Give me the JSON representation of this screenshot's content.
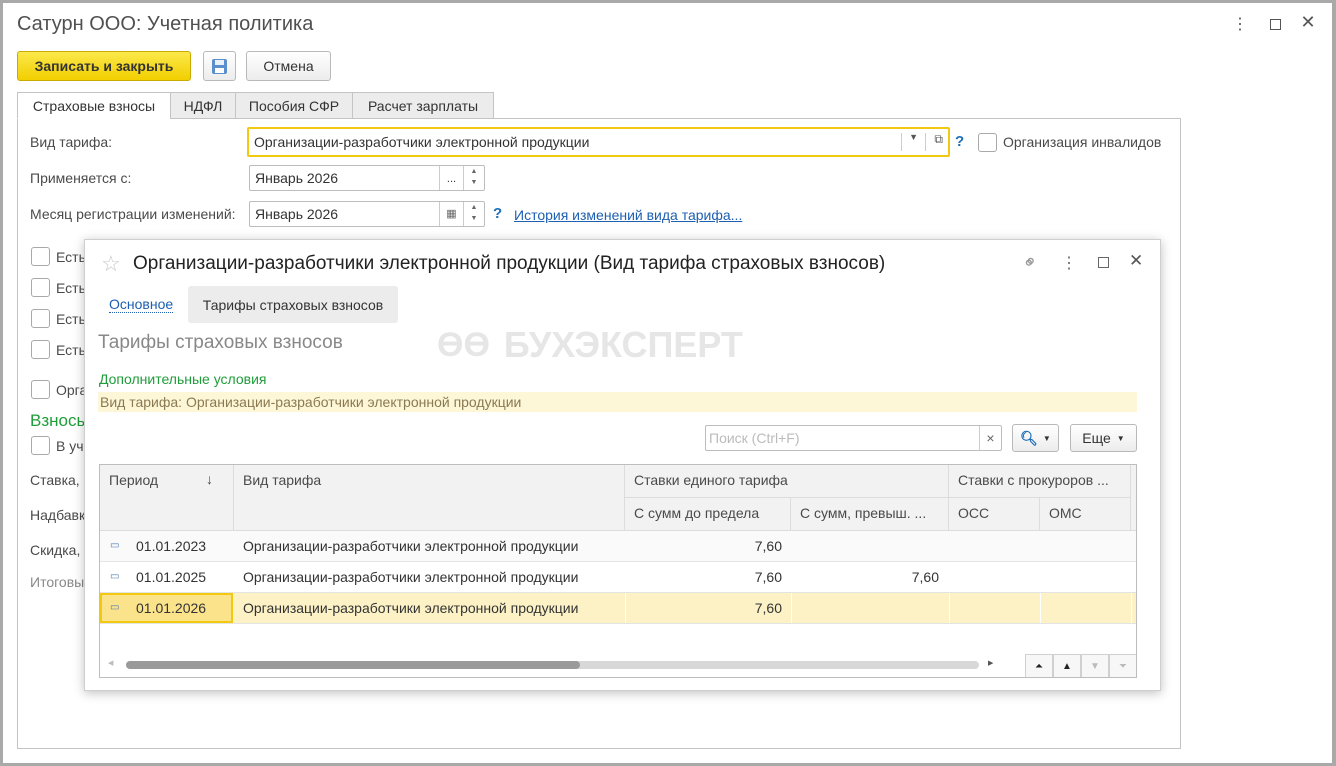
{
  "window": {
    "title": "Сатурн ООО: Учетная политика"
  },
  "toolbar": {
    "save_close": "Записать и закрыть",
    "cancel": "Отмена"
  },
  "tabs": [
    {
      "label": "Страховые взносы"
    },
    {
      "label": "НДФЛ"
    },
    {
      "label": "Пособия СФР"
    },
    {
      "label": "Расчет зарплаты"
    }
  ],
  "form": {
    "tariff_label": "Вид тарифа:",
    "tariff_value": "Организации-разработчики электронной продукции",
    "disabled_org": "Организация инвалидов",
    "applies_label": "Применяется с:",
    "applies_value": "Январь 2026",
    "reg_month_label": "Месяц регистрации изменений:",
    "reg_month_value": "Январь 2026",
    "history_link": "История изменений вида тарифа...",
    "help": "?",
    "hidden_checks": [
      "Есть",
      "Есть",
      "Есть",
      "Есть",
      "Орга"
    ],
    "section": "Взносы",
    "check_v": "В уч",
    "rows": [
      "Ставка,",
      "Надбавка",
      "Скидка,",
      "Итоговы"
    ]
  },
  "dialog": {
    "title": "Организации-разработчики электронной продукции (Вид тарифа страховых взносов)",
    "tab_main": "Основное",
    "tab_rates": "Тарифы страховых взносов",
    "heading": "Тарифы страховых взносов",
    "watermark": "БУХЭКСПЕРТ",
    "extra_conditions": "Дополнительные условия",
    "tariff_info": "Вид тарифа: Организации-разработчики электронной продукции",
    "search_placeholder": "Поиск (Ctrl+F)",
    "clear": "×",
    "more": "Еще",
    "columns": {
      "period": "Период",
      "sort": "↓",
      "type": "Вид тарифа",
      "unified": "Ставки единого тарифа",
      "up_to": "С сумм до предела",
      "over": "С сумм, превыш. ...",
      "prosecutors": "Ставки с прокуроров ...",
      "oss": "ОСС",
      "oms": "ОМС"
    },
    "rows": [
      {
        "period": "01.01.2023",
        "type": "Организации-разработчики электронной продукции",
        "up_to": "7,60",
        "over": ""
      },
      {
        "period": "01.01.2025",
        "type": "Организации-разработчики электронной продукции",
        "up_to": "7,60",
        "over": "7,60"
      },
      {
        "period": "01.01.2026",
        "type": "Организации-разработчики электронной продукции",
        "up_to": "7,60",
        "over": "",
        "selected": true
      }
    ]
  }
}
